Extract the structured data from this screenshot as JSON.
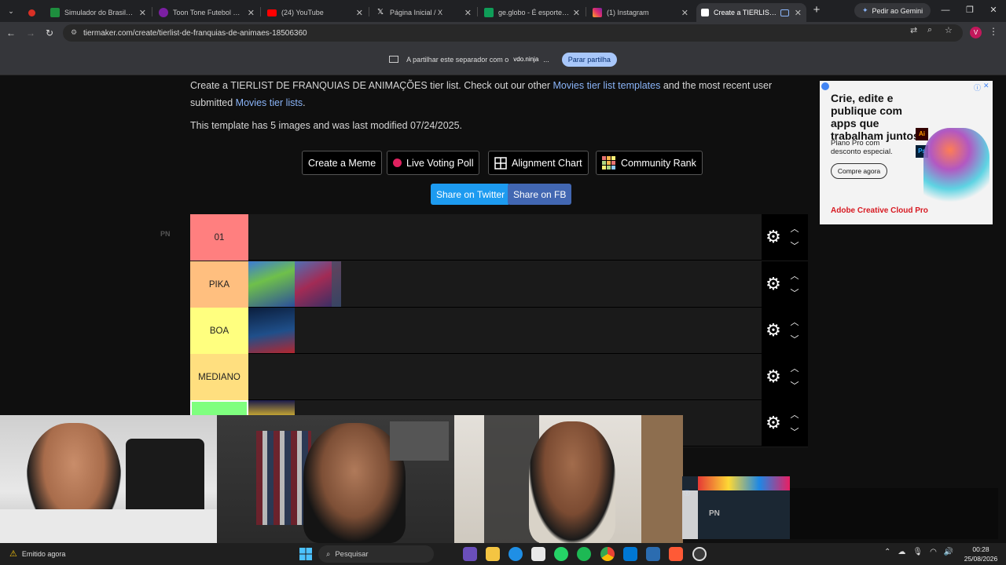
{
  "browser": {
    "tabs": [
      {
        "title": "Simulador do Brasileirão",
        "favicon_color": "#1e8e3e"
      },
      {
        "title": "Toon Tone Futebol — Ac",
        "favicon_color": "#7b1fa2"
      },
      {
        "title": "(24) YouTube",
        "favicon_color": "#ff0000"
      },
      {
        "title": "Página Inicial / X",
        "favicon_color": "#000000"
      },
      {
        "title": "ge.globo - É esporte sem",
        "favicon_color": "#0f9d58"
      },
      {
        "title": "(1) Instagram",
        "favicon_color": "#e1306c"
      },
      {
        "title": "Create a TIERLIST DE",
        "favicon_color": "#ffffff"
      }
    ],
    "new_tab": "+",
    "gemini_label": "Pedir ao Gemini",
    "url": "tiermaker.com/create/tierlist-de-franquias-de-animaes-18506360",
    "profile_initial": "V"
  },
  "sharing_bar": {
    "text": "A partilhar este separador com o",
    "app": "vdo.ninja",
    "ellipsis": "...",
    "stop_label": "Parar partilha"
  },
  "page": {
    "intro_1": "Create a TIERLIST DE FRANQUIAS DE ANIMAÇÕES tier list. Check out our other ",
    "intro_link_1": "Movies tier list templates",
    "intro_2": " and the most recent user submitted ",
    "intro_link_2": "Movies tier lists",
    "intro_3": ".",
    "modified": "This template has 5 images and was last modified 07/24/2025.",
    "buttons": {
      "meme": "Create a Meme",
      "poll": "Live Voting Poll",
      "alignment": "Alignment Chart",
      "community": "Community Rank",
      "twitter": "Share on Twitter",
      "fb": "Share on FB"
    },
    "tiers": [
      {
        "label": "01",
        "color": "#ff7f7f"
      },
      {
        "label": "PIKA",
        "color": "#ffbf7f"
      },
      {
        "label": "BOA",
        "color": "#ffff7f"
      },
      {
        "label": "MEDIANO",
        "color": "#ffdf7f"
      },
      {
        "label": "",
        "color": "#7fff7f"
      }
    ]
  },
  "ad": {
    "headline": "Crie, edite e publique com apps que trabalham juntos.",
    "sub": "Plano Pro com desconto especial.",
    "cta": "Compre agora",
    "brand": "Adobe Creative Cloud Pro",
    "watermark": "PN"
  },
  "overlay": {
    "extra_cam_label": "PN"
  },
  "taskbar": {
    "notification": "Emitido agora",
    "search_placeholder": "Pesquisar",
    "time": "00:28",
    "date": "25/08/2026"
  }
}
